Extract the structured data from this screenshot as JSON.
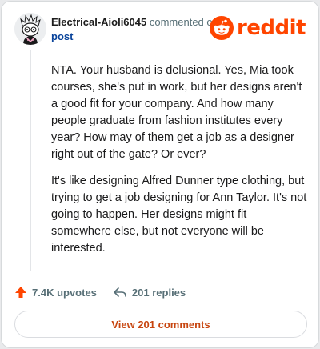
{
  "comment": {
    "username": "Electrical-Aioli6045",
    "verb": "commented on",
    "link_text": "post",
    "paragraphs": [
      "NTA. Your husband is delusional. Yes, Mia took courses, she's put in work, but her designs aren't a good fit for your company. And how many people graduate from fashion institutes every year? How may of them get a job as a designer right out of the gate? Or ever?",
      "It's like designing Alfred Dunner type clothing, but trying to get a job designing for Ann Taylor. It's not going to happen. Her designs might fit somewhere else, but not everyone will be interested."
    ]
  },
  "brand": {
    "name": "reddit",
    "color": "#ff4500"
  },
  "actions": {
    "upvotes": "7.4K upvotes",
    "replies": "201 replies"
  },
  "view_button": {
    "label": "View 201 comments"
  },
  "icons": {
    "upvote": "upvote-arrow-icon",
    "reply": "reply-arrow-icon",
    "logo": "reddit-snoo-icon",
    "avatar": "snoo-avatar-icon"
  }
}
